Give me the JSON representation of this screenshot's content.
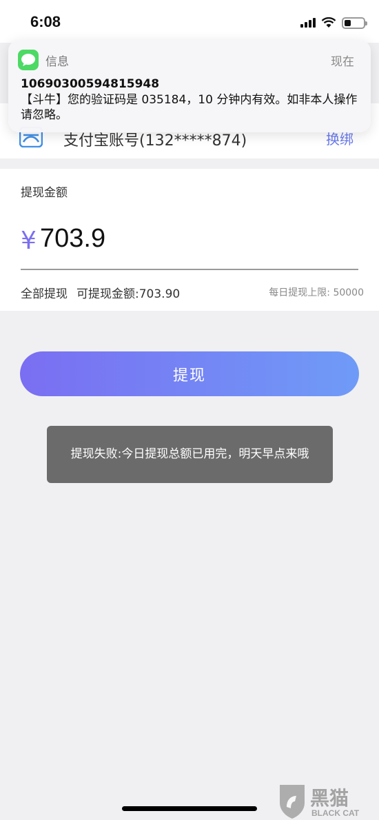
{
  "status_bar": {
    "time": "6:08"
  },
  "notification": {
    "app_name": "信息",
    "time": "现在",
    "sender": "10690300594815948",
    "body": "【斗牛】您的验证码是 035184，10 分钟内有效。如非本人操作请忽略。"
  },
  "account": {
    "text": "支付宝账号(132*****874)",
    "change_label": "换绑",
    "icon": "alipay-icon"
  },
  "amount": {
    "label": "提现金额",
    "currency": "¥",
    "value": "703.9",
    "withdraw_all": "全部提现",
    "available": "可提现金额:703.90",
    "daily_limit": "每日提现上限: 50000"
  },
  "withdraw_button": "提现",
  "toast": "提现失败:今日提现总额已用完，明天早点来哦",
  "watermark": {
    "main": "黑猫",
    "sub": "BLACK CAT"
  },
  "colors": {
    "accent_start": "#7a6ef2",
    "accent_end": "#6f9bf7",
    "link": "#6b7bf0"
  }
}
